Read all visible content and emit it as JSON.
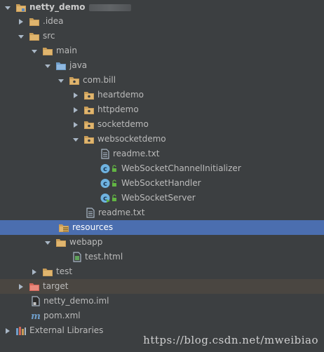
{
  "tree": {
    "items": [
      {
        "label": "netty_demo"
      },
      {
        "label": ".idea"
      },
      {
        "label": "src"
      },
      {
        "label": "main"
      },
      {
        "label": "java"
      },
      {
        "label": "com.bill"
      },
      {
        "label": "heartdemo"
      },
      {
        "label": "httpdemo"
      },
      {
        "label": "socketdemo"
      },
      {
        "label": "websocketdemo"
      },
      {
        "label": "readme.txt"
      },
      {
        "label": "WebSocketChannelInitializer"
      },
      {
        "label": "WebSocketHandler"
      },
      {
        "label": "WebSocketServer"
      },
      {
        "label": "readme.txt"
      },
      {
        "label": "resources"
      },
      {
        "label": "webapp"
      },
      {
        "label": "test.html"
      },
      {
        "label": "test"
      },
      {
        "label": "target"
      },
      {
        "label": "netty_demo.iml"
      },
      {
        "label": "pom.xml"
      },
      {
        "label": "External Libraries"
      }
    ]
  },
  "watermark": "https://blog.csdn.net/mweibiao",
  "colors": {
    "background": "#3c3f41",
    "selection": "#4b6eaf",
    "folder": "#c99d58",
    "source_folder": "#6e9dc9",
    "excluded_folder": "#d1675a",
    "text": "#bbbbbb"
  }
}
